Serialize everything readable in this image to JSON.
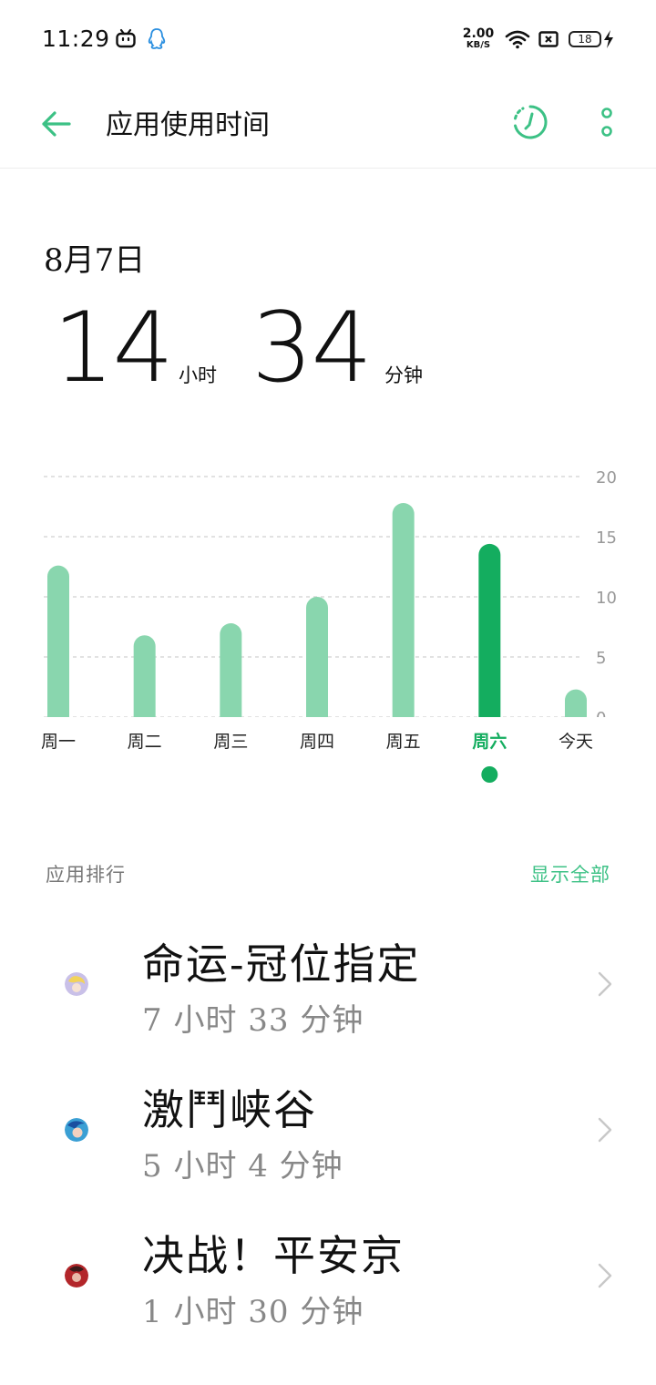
{
  "status_bar": {
    "time": "11:29",
    "net_speed_value": "2.00",
    "net_speed_unit": "KB/S",
    "battery": "18",
    "icons": [
      "bilibili-icon",
      "qq-icon",
      "wifi-icon",
      "sim-icon",
      "battery-icon",
      "charging-icon"
    ]
  },
  "app_bar": {
    "title": "应用使用时间",
    "back_icon": "arrow-left-icon",
    "timer_icon": "timer-icon",
    "more_icon": "more-vertical-icon"
  },
  "summary": {
    "date": "8月7日",
    "hours": "14",
    "hours_unit": "小时",
    "minutes": "34",
    "minutes_unit": "分钟"
  },
  "chart_data": {
    "type": "bar",
    "categories": [
      "周一",
      "周二",
      "周三",
      "周四",
      "周五",
      "周六",
      "今天"
    ],
    "values": [
      12.6,
      6.8,
      7.8,
      10.0,
      17.8,
      14.4,
      2.3
    ],
    "selected_index": 5,
    "y_ticks": [
      "20",
      "15",
      "10",
      "5",
      "0"
    ],
    "ylim": [
      0,
      20
    ],
    "grid": true,
    "colors": {
      "bar": "#89d6ae",
      "selected": "#14ad5f",
      "selected_label": "#14ad5f",
      "label": "#222222",
      "grid": "#d8d8d8",
      "tick": "#999999"
    }
  },
  "ranking": {
    "label": "应用排行",
    "show_all": "显示全部",
    "items": [
      {
        "name": "命运-冠位指定",
        "time": "7 小时 33 分钟",
        "avatar_color": "#c9c0e8"
      },
      {
        "name": "激鬥峡谷",
        "time": "5 小时 4 分钟",
        "avatar_color": "#3a9fd4"
      },
      {
        "name": "决战！平安京",
        "time": "1 小时 30 分钟",
        "avatar_color": "#b3262a"
      }
    ]
  },
  "colors": {
    "accent": "#3cc185"
  }
}
